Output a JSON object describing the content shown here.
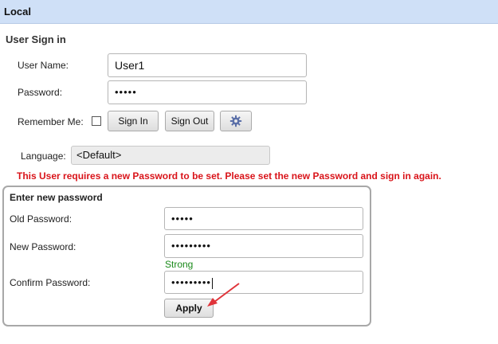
{
  "header": {
    "title": "Local"
  },
  "signin": {
    "title": "User Sign in",
    "username_label": "User Name:",
    "username_value": "User1",
    "password_label": "Password:",
    "password_value": "•••••",
    "remember_label": "Remember Me:",
    "sign_in_label": "Sign In",
    "sign_out_label": "Sign Out",
    "language_label": "Language:",
    "language_value": "<Default>"
  },
  "warning": "This User requires a new Password to be set. Please set the new Password and sign in again.",
  "new_password": {
    "title": "Enter new password",
    "old_label": "Old Password:",
    "old_value": "•••••",
    "new_label": "New Password:",
    "new_value": "•••••••••",
    "strength": "Strong",
    "confirm_label": "Confirm Password:",
    "confirm_value": "•••••••••",
    "apply_label": "Apply"
  },
  "colors": {
    "header_bg": "#cfe0f7",
    "warning": "#d9141a",
    "strength": "#1a8a1a",
    "arrow": "#e0343a"
  }
}
